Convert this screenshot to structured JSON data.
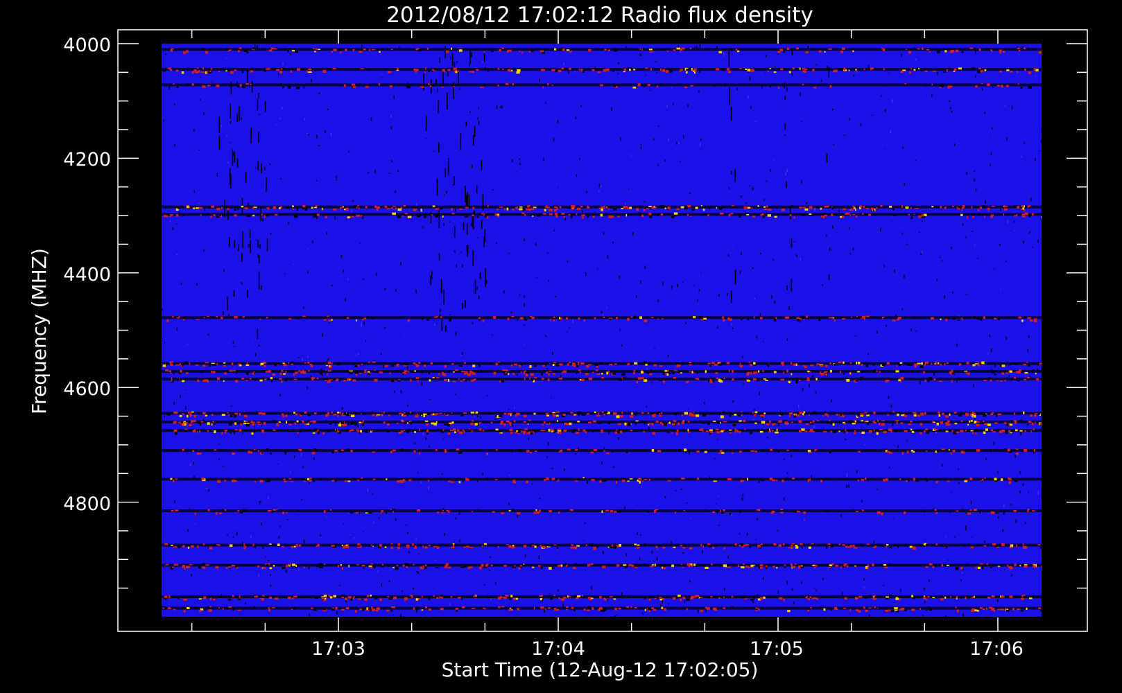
{
  "chart_data": {
    "type": "heatmap",
    "title": "2012/08/12 17:02:12 Radio flux density",
    "xlabel": "Start Time (12-Aug-12 17:02:05)",
    "ylabel": "Frequency (MHZ)",
    "x_ticks": [
      "17:03",
      "17:04",
      "17:05",
      "17:06"
    ],
    "y_ticks": [
      "4000",
      "4200",
      "4400",
      "4600",
      "4800"
    ],
    "x_range": [
      "17:02:05",
      "17:06:13"
    ],
    "y_range": [
      4000,
      5000
    ],
    "background_color": "#1c10e8",
    "colors": {
      "low": "#000000",
      "base": "#1c10e8",
      "mid": "#d02020",
      "high": "#ffd000"
    },
    "bands": [
      {
        "freq": 4010,
        "intensity": 0.5
      },
      {
        "freq": 4045,
        "intensity": 0.75
      },
      {
        "freq": 4072,
        "intensity": 0.3
      },
      {
        "freq": 4285,
        "intensity": 0.95
      },
      {
        "freq": 4298,
        "intensity": 0.6
      },
      {
        "freq": 4478,
        "intensity": 0.55
      },
      {
        "freq": 4558,
        "intensity": 0.85
      },
      {
        "freq": 4572,
        "intensity": 0.8
      },
      {
        "freq": 4585,
        "intensity": 0.6
      },
      {
        "freq": 4645,
        "intensity": 1.0
      },
      {
        "freq": 4660,
        "intensity": 1.0
      },
      {
        "freq": 4675,
        "intensity": 0.9
      },
      {
        "freq": 4710,
        "intensity": 0.45
      },
      {
        "freq": 4760,
        "intensity": 0.5
      },
      {
        "freq": 4815,
        "intensity": 0.4
      },
      {
        "freq": 4875,
        "intensity": 0.85
      },
      {
        "freq": 4910,
        "intensity": 0.9
      },
      {
        "freq": 4965,
        "intensity": 0.8
      },
      {
        "freq": 4985,
        "intensity": 0.7
      }
    ]
  }
}
